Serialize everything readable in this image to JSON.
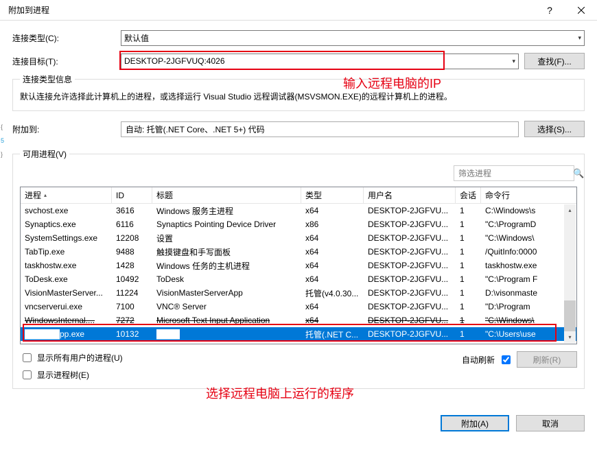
{
  "title": "附加到进程",
  "rows": {
    "conn_type_label": "连接类型(C):",
    "conn_type_value": "默认值",
    "conn_target_label": "连接目标(T):",
    "conn_target_value": "DESKTOP-2JGFVUQ:4026",
    "find_btn": "查找(F)...",
    "conn_info_legend": "连接类型信息",
    "conn_info_text": "默认连接允许选择此计算机上的进程，或选择运行 Visual Studio 远程调试器(MSVSMON.EXE)的远程计算机上的进程。",
    "attach_to_label": "附加到:",
    "attach_to_value": "自动: 托管(.NET Core、.NET 5+) 代码",
    "select_btn": "选择(S)..."
  },
  "avail": {
    "legend": "可用进程(V)",
    "filter_placeholder": "筛选进程"
  },
  "columns": {
    "proc": "进程",
    "id": "ID",
    "title": "标题",
    "type": "类型",
    "user": "用户名",
    "session": "会话",
    "cmd": "命令行"
  },
  "rows_data": [
    {
      "proc": "svchost.exe",
      "id": "3616",
      "title": "Windows 服务主进程",
      "type": "x64",
      "user": "DESKTOP-2JGFVU...",
      "session": "1",
      "cmd": "C:\\Windows\\s"
    },
    {
      "proc": "Synaptics.exe",
      "id": "6116",
      "title": "Synaptics Pointing Device Driver",
      "type": "x86",
      "user": "DESKTOP-2JGFVU...",
      "session": "1",
      "cmd": "\"C:\\ProgramD"
    },
    {
      "proc": "SystemSettings.exe",
      "id": "12208",
      "title": "设置",
      "type": "x64",
      "user": "DESKTOP-2JGFVU...",
      "session": "1",
      "cmd": "\"C:\\Windows\\"
    },
    {
      "proc": "TabTip.exe",
      "id": "9488",
      "title": "触摸键盘和手写面板",
      "type": "x64",
      "user": "DESKTOP-2JGFVU...",
      "session": "1",
      "cmd": "/QuitInfo:0000"
    },
    {
      "proc": "taskhostw.exe",
      "id": "1428",
      "title": "Windows 任务的主机进程",
      "type": "x64",
      "user": "DESKTOP-2JGFVU...",
      "session": "1",
      "cmd": "taskhostw.exe"
    },
    {
      "proc": "ToDesk.exe",
      "id": "10492",
      "title": "ToDesk",
      "type": "x64",
      "user": "DESKTOP-2JGFVU...",
      "session": "1",
      "cmd": "\"C:\\Program F"
    },
    {
      "proc": "VisionMasterServer...",
      "id": "11224",
      "title": "VisionMasterServerApp",
      "type": "托管(v4.0.30...",
      "user": "DESKTOP-2JGFVU...",
      "session": "1",
      "cmd": "D:\\visonmaste"
    },
    {
      "proc": "vncserverui.exe",
      "id": "7100",
      "title": "VNC® Server",
      "type": "x64",
      "user": "DESKTOP-2JGFVU...",
      "session": "1",
      "cmd": "\"D:\\Program"
    },
    {
      "proc": "WindowsInternal....",
      "id": "7272",
      "title": "Microsoft Text Input Application",
      "type": "x64",
      "user": "DESKTOP-2JGFVU...",
      "session": "1",
      "cmd": "\"C:\\Windows\\"
    },
    {
      "proc": "██████pp.exe",
      "id": "10132",
      "title": "████",
      "type": "托管(.NET C...",
      "user": "DESKTOP-2JGFVU...",
      "session": "1",
      "cmd": "\"C:\\Users\\use"
    }
  ],
  "under": {
    "show_all_users": "显示所有用户的进程(U)",
    "show_tree": "显示进程树(E)",
    "auto_refresh": "自动刷新",
    "refresh_btn": "刷新(R)"
  },
  "annotations": {
    "ip_hint": "输入远程电脑的IP",
    "select_hint": "选择远程电脑上运行的程序"
  },
  "footer": {
    "attach": "附加(A)",
    "cancel": "取消"
  }
}
